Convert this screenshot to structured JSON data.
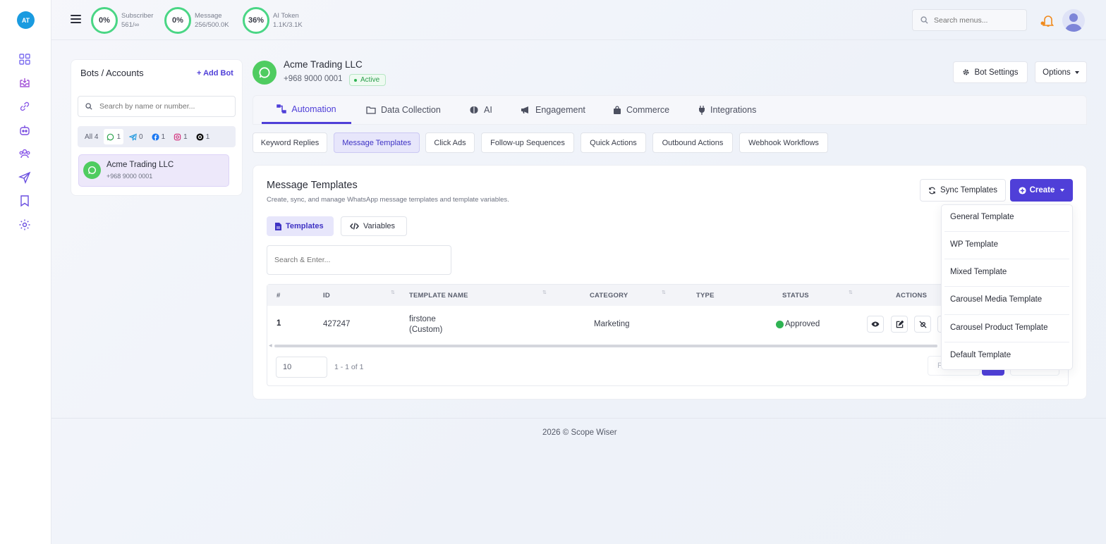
{
  "rail": {
    "avatar_initials": "AT",
    "icons": [
      "dashboard-icon",
      "inbox-icon",
      "link-icon",
      "bot-icon",
      "users-icon",
      "send-icon",
      "bookmark-icon",
      "settings-icon"
    ]
  },
  "topbar": {
    "stats": [
      {
        "percent": "0%",
        "label": "Subscriber",
        "value": "561/∞"
      },
      {
        "percent": "0%",
        "label": "Message",
        "value": "256/500.0K"
      },
      {
        "percent": "36%",
        "label": "AI Token",
        "value": "1.1K/3.1K"
      }
    ],
    "search_placeholder": "Search menus..."
  },
  "bots": {
    "title": "Bots / Accounts",
    "add_label": "Add Bot",
    "search_placeholder": "Search by name or number...",
    "filters": [
      {
        "icon": "",
        "label": "All 4"
      },
      {
        "icon": "whatsapp-icon",
        "label": "1"
      },
      {
        "icon": "telegram-icon",
        "label": "0"
      },
      {
        "icon": "facebook-icon",
        "label": "1"
      },
      {
        "icon": "instagram-icon",
        "label": "1"
      },
      {
        "icon": "threads-icon",
        "label": "1"
      }
    ],
    "items": [
      {
        "name": "Acme Trading LLC",
        "phone": "+968 9000 0001"
      }
    ]
  },
  "header": {
    "name": "Acme Trading LLC",
    "phone": "+968 9000 0001",
    "status": "Active",
    "bot_settings": "Bot Settings",
    "options": "Options"
  },
  "tabs": [
    {
      "icon": "flow-icon",
      "label": "Automation"
    },
    {
      "icon": "folder-icon",
      "label": "Data Collection"
    },
    {
      "icon": "brain-icon",
      "label": "AI"
    },
    {
      "icon": "megaphone-icon",
      "label": "Engagement"
    },
    {
      "icon": "bag-icon",
      "label": "Commerce"
    },
    {
      "icon": "plug-icon",
      "label": "Integrations"
    }
  ],
  "subtabs": [
    "Keyword Replies",
    "Message Templates",
    "Click Ads",
    "Follow-up Sequences",
    "Quick Actions",
    "Outbound Actions",
    "Webhook Workflows"
  ],
  "templates": {
    "title": "Message Templates",
    "subtitle": "Create, sync, and manage WhatsApp message templates and template variables.",
    "sync_label": "Sync Templates",
    "create_label": "Create",
    "pills": [
      "Templates",
      "Variables"
    ],
    "search_placeholder": "Search & Enter...",
    "columns": [
      "#",
      "ID",
      "TEMPLATE NAME",
      "CATEGORY",
      "TYPE",
      "STATUS",
      "ACTIONS"
    ],
    "rows": [
      {
        "num": "1",
        "id": "427247",
        "name_line1": "firstone",
        "name_line2": "(Custom)",
        "category": "Marketing",
        "type": "",
        "status": "Approved"
      }
    ],
    "per_page": "10",
    "range": "1 - 1 of 1",
    "page_prefix": "P"
  },
  "create_menu": [
    "General Template",
    "WP Template",
    "Mixed Template",
    "Carousel Media Template",
    "Carousel Product Template",
    "Default Template"
  ],
  "footer": "2026 © Scope Wiser",
  "colors": {
    "accent": "#4f3fd8",
    "success": "#2fb353",
    "whatsapp": "#4fcc60",
    "ring": "#4ad685"
  }
}
